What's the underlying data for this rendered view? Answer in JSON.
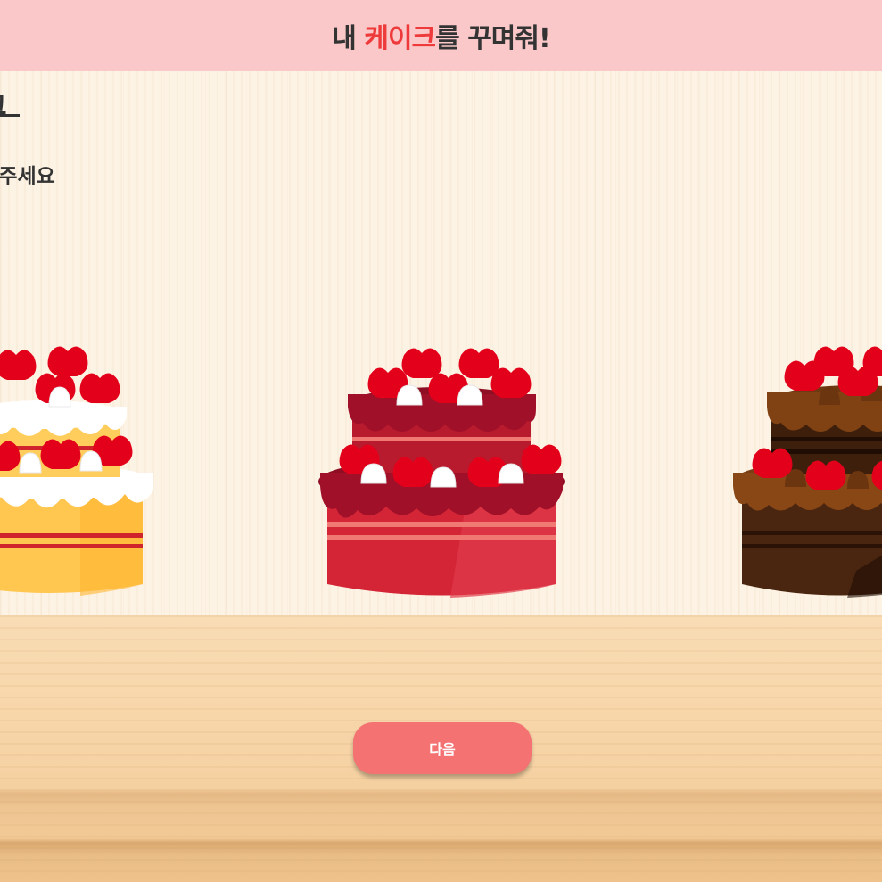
{
  "header": {
    "title_prefix": "내 ",
    "title_accent": "케이크",
    "title_suffix": "를 꾸며줘!",
    "accent_color": "#ee3a3a",
    "background": "#fac8c8"
  },
  "main": {
    "section_title": "크",
    "instruction": "택해주세요"
  },
  "cakes": [
    {
      "id": "vanilla",
      "icon": "vanilla-cake-icon"
    },
    {
      "id": "red-velvet",
      "icon": "red-velvet-cake-icon"
    },
    {
      "id": "chocolate",
      "icon": "chocolate-cake-icon"
    }
  ],
  "next_button": {
    "label": "다음",
    "color": "#f47272"
  }
}
